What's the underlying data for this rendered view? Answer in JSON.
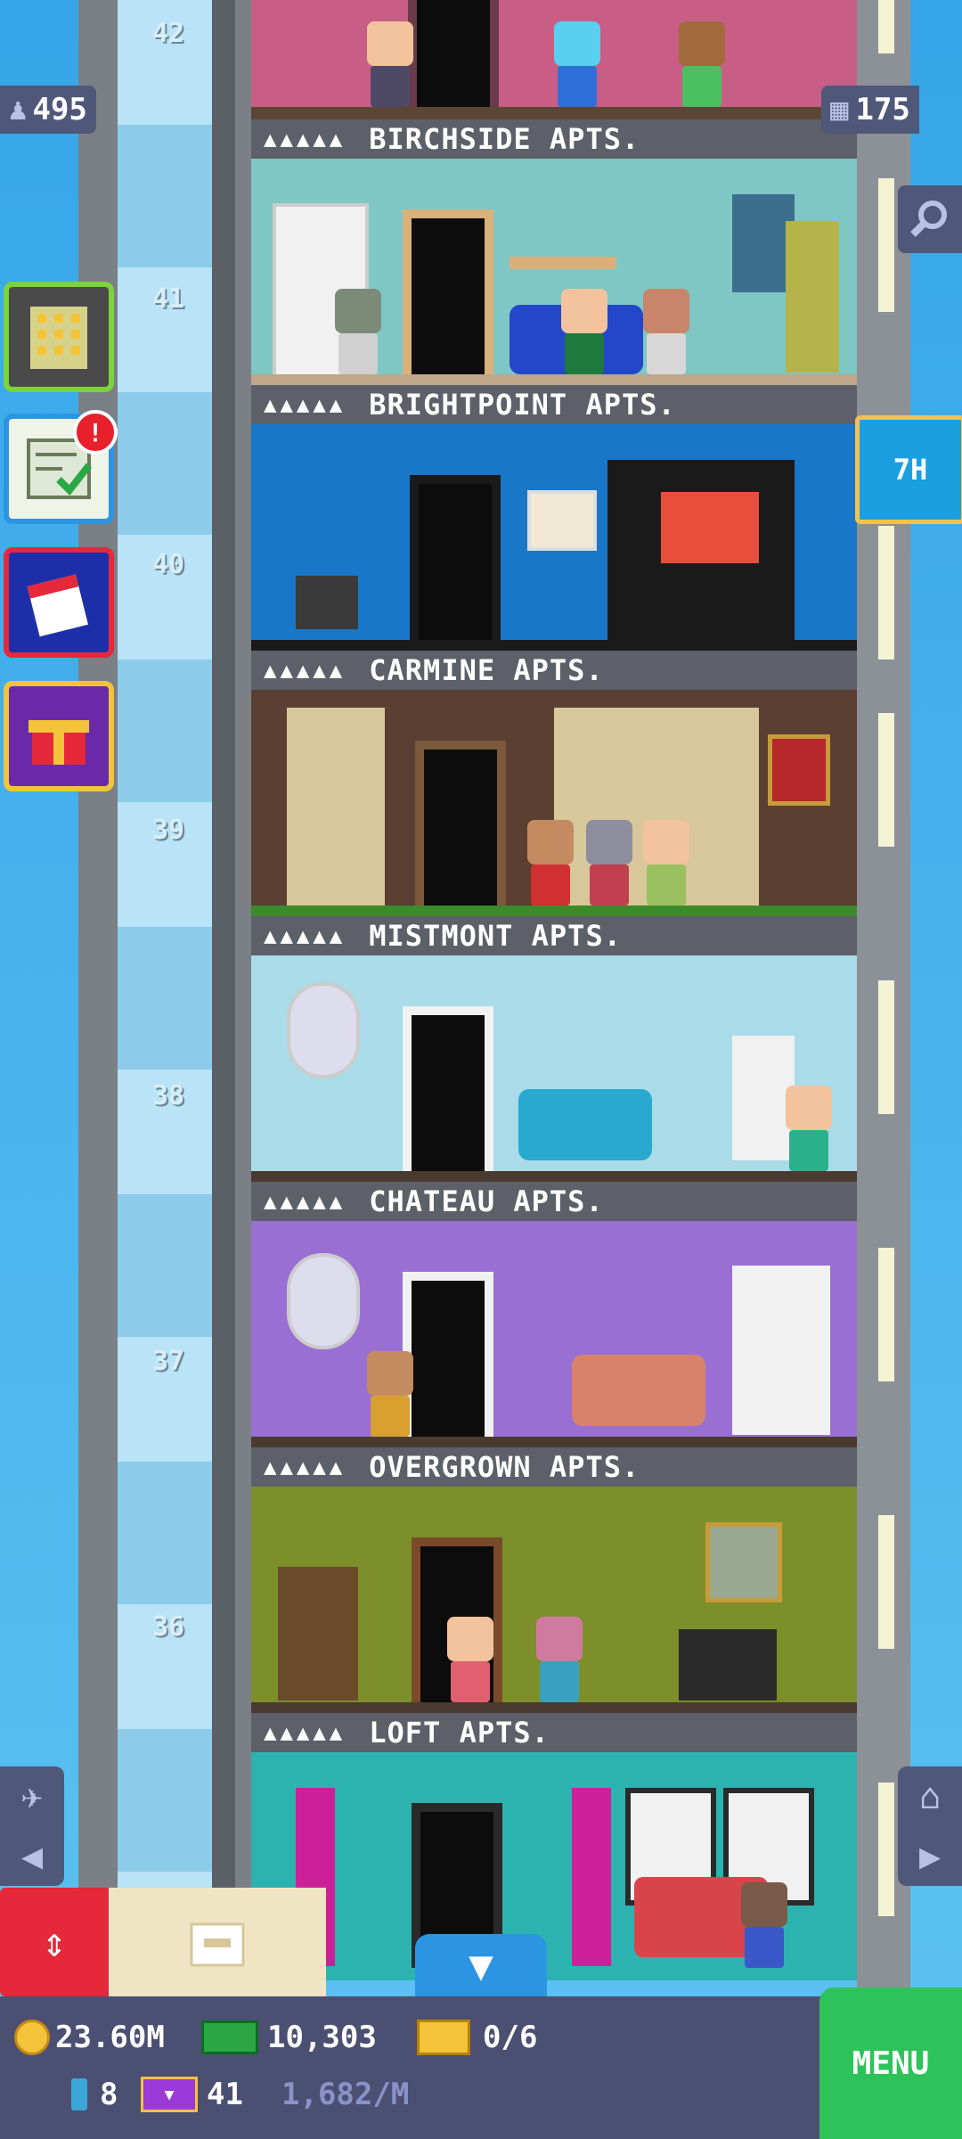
{
  "hud": {
    "residents": "495",
    "floors": "175",
    "timer": "7H"
  },
  "floors": [
    {
      "number": "42",
      "name": "BIRCHSIDE APTS."
    },
    {
      "number": "41",
      "name": "BRIGHTPOINT APTS."
    },
    {
      "number": "40",
      "name": "CARMINE APTS."
    },
    {
      "number": "39",
      "name": "MISTMONT APTS."
    },
    {
      "number": "38",
      "name": "CHATEAU APTS."
    },
    {
      "number": "37",
      "name": "OVERGROWN APTS."
    },
    {
      "number": "36",
      "name": "LOFT APTS."
    }
  ],
  "bottom_bar": {
    "coins": "23.60M",
    "bux": "10,303",
    "tickets": "0/6",
    "gems": "8",
    "vip": "41",
    "rate": "1,682/M",
    "menu_label": "MENU"
  },
  "occupancy_icons": "▲▲▲▲▲",
  "colors": {
    "accent": "#2ec25a",
    "elevator_button": "#e5283a",
    "timer_button": "#1aa0e0"
  }
}
